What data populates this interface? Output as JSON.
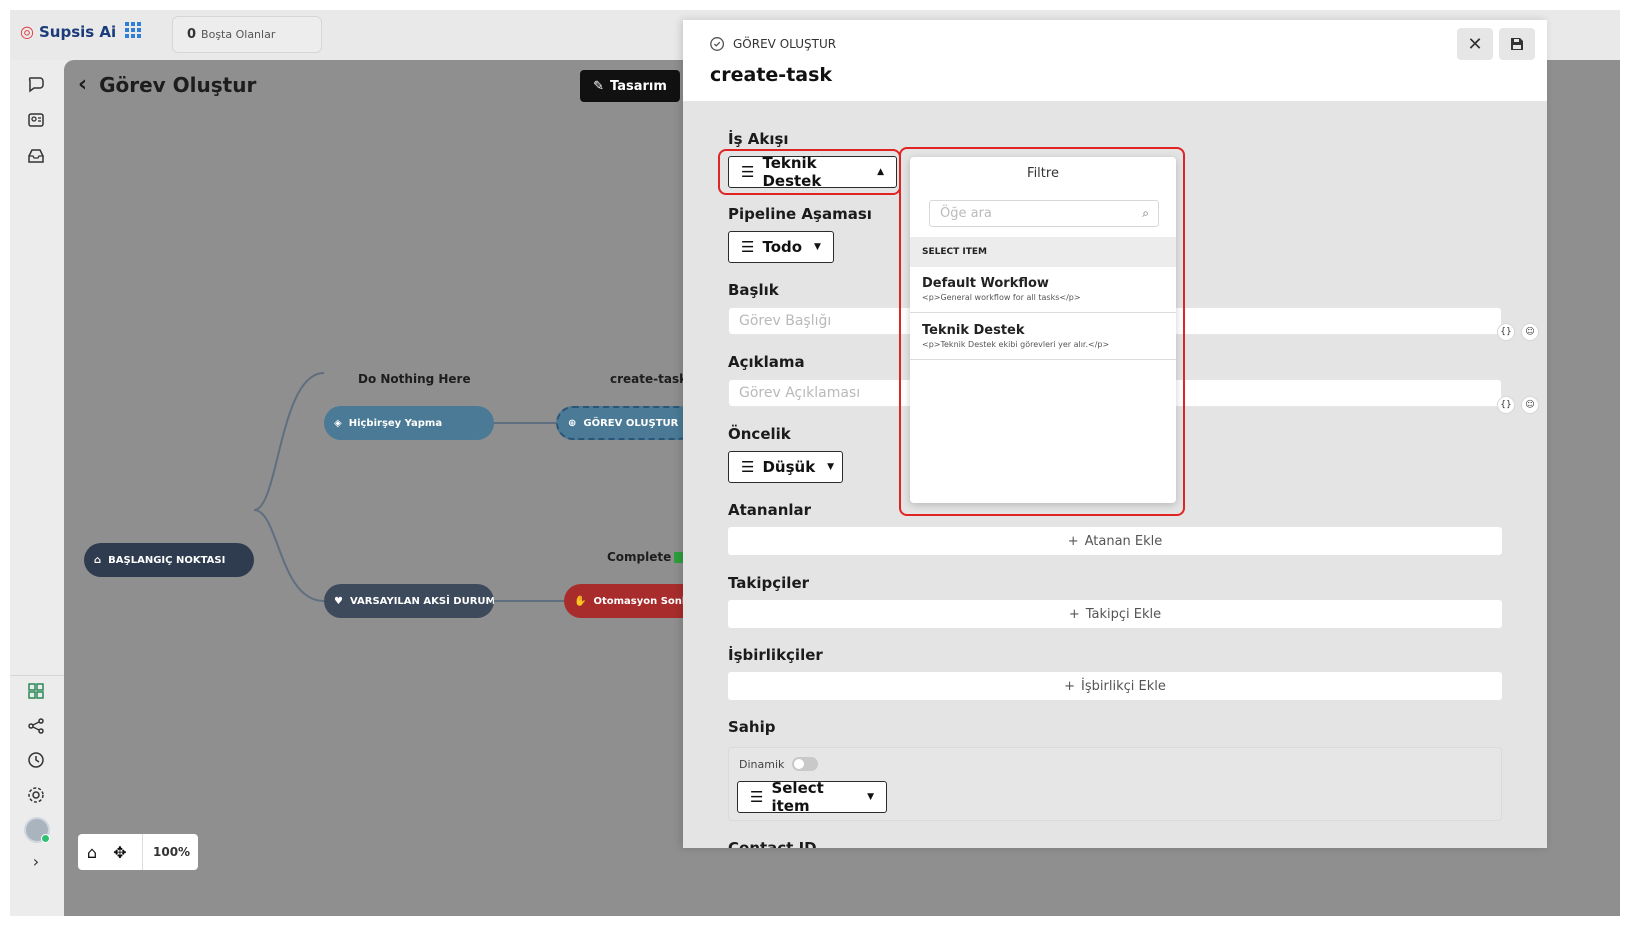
{
  "app": {
    "name": "Supsis Ai"
  },
  "idle": {
    "count": "0",
    "label": "Boşta Olanlar"
  },
  "canvas": {
    "title": "Görev Oluştur",
    "design_button": "Tasarım",
    "zoom": "100%",
    "nodes": {
      "start": "BAŞLANGIÇ NOKTASI",
      "nothing": "Hiçbirşey Yapma",
      "nothing_caption": "Do Nothing Here",
      "default_else": "VARSAYILAN AKSİ DURUM",
      "create": "GÖREV OLUŞTUR",
      "create_caption": "create-task",
      "end": "Otomasyon Sonl",
      "end_caption": "Complete"
    }
  },
  "panel": {
    "kicker": "GÖREV OLUŞTUR",
    "name": "create-task",
    "fields": {
      "workflow_label": "İş Akışı",
      "workflow_value": "Teknik Destek",
      "stage_label": "Pipeline Aşaması",
      "stage_value": "Todo",
      "title_label": "Başlık",
      "title_placeholder": "Görev Başlığı",
      "desc_label": "Açıklama",
      "desc_placeholder": "Görev Açıklaması",
      "priority_label": "Öncelik",
      "priority_value": "Düşük",
      "assignees_label": "Atananlar",
      "assignees_add": "Atanan Ekle",
      "followers_label": "Takipçiler",
      "followers_add": "Takipçi Ekle",
      "collab_label": "İşbirlikçiler",
      "collab_add": "İşbirlikçi Ekle",
      "owner_label": "Sahip",
      "dynamic_label": "Dinamik",
      "owner_select": "Select item",
      "contact_label": "Contact ID"
    }
  },
  "popover": {
    "title": "Filtre",
    "search_placeholder": "Öğe ara",
    "section": "SELECT ITEM",
    "items": [
      {
        "name": "Default Workflow",
        "desc": "<p>General workflow for all tasks</p>"
      },
      {
        "name": "Teknik Destek",
        "desc": "<p>Teknik Destek ekibi görevleri yer alır.</p>"
      }
    ]
  },
  "colors": {
    "highlight": "#e02424",
    "brand": "#1c3b7a",
    "canvas": "#8f8f8f"
  }
}
